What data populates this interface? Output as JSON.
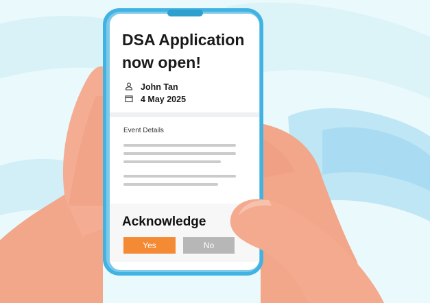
{
  "screen": {
    "title": "DSA Application now open!",
    "author": {
      "icon": "person-icon",
      "name": "John Tan"
    },
    "date": {
      "icon": "calendar-icon",
      "value": "4 May 2025"
    },
    "section_label": "Event Details",
    "acknowledge": {
      "heading": "Acknowledge",
      "yes_label": "Yes",
      "no_label": "No"
    }
  },
  "colors": {
    "background": "#eaf9fb",
    "phone_frame": "#40b3e3",
    "skin": "#f2a68a",
    "yes_button": "#f58a34",
    "no_button": "#b7b7b7"
  }
}
